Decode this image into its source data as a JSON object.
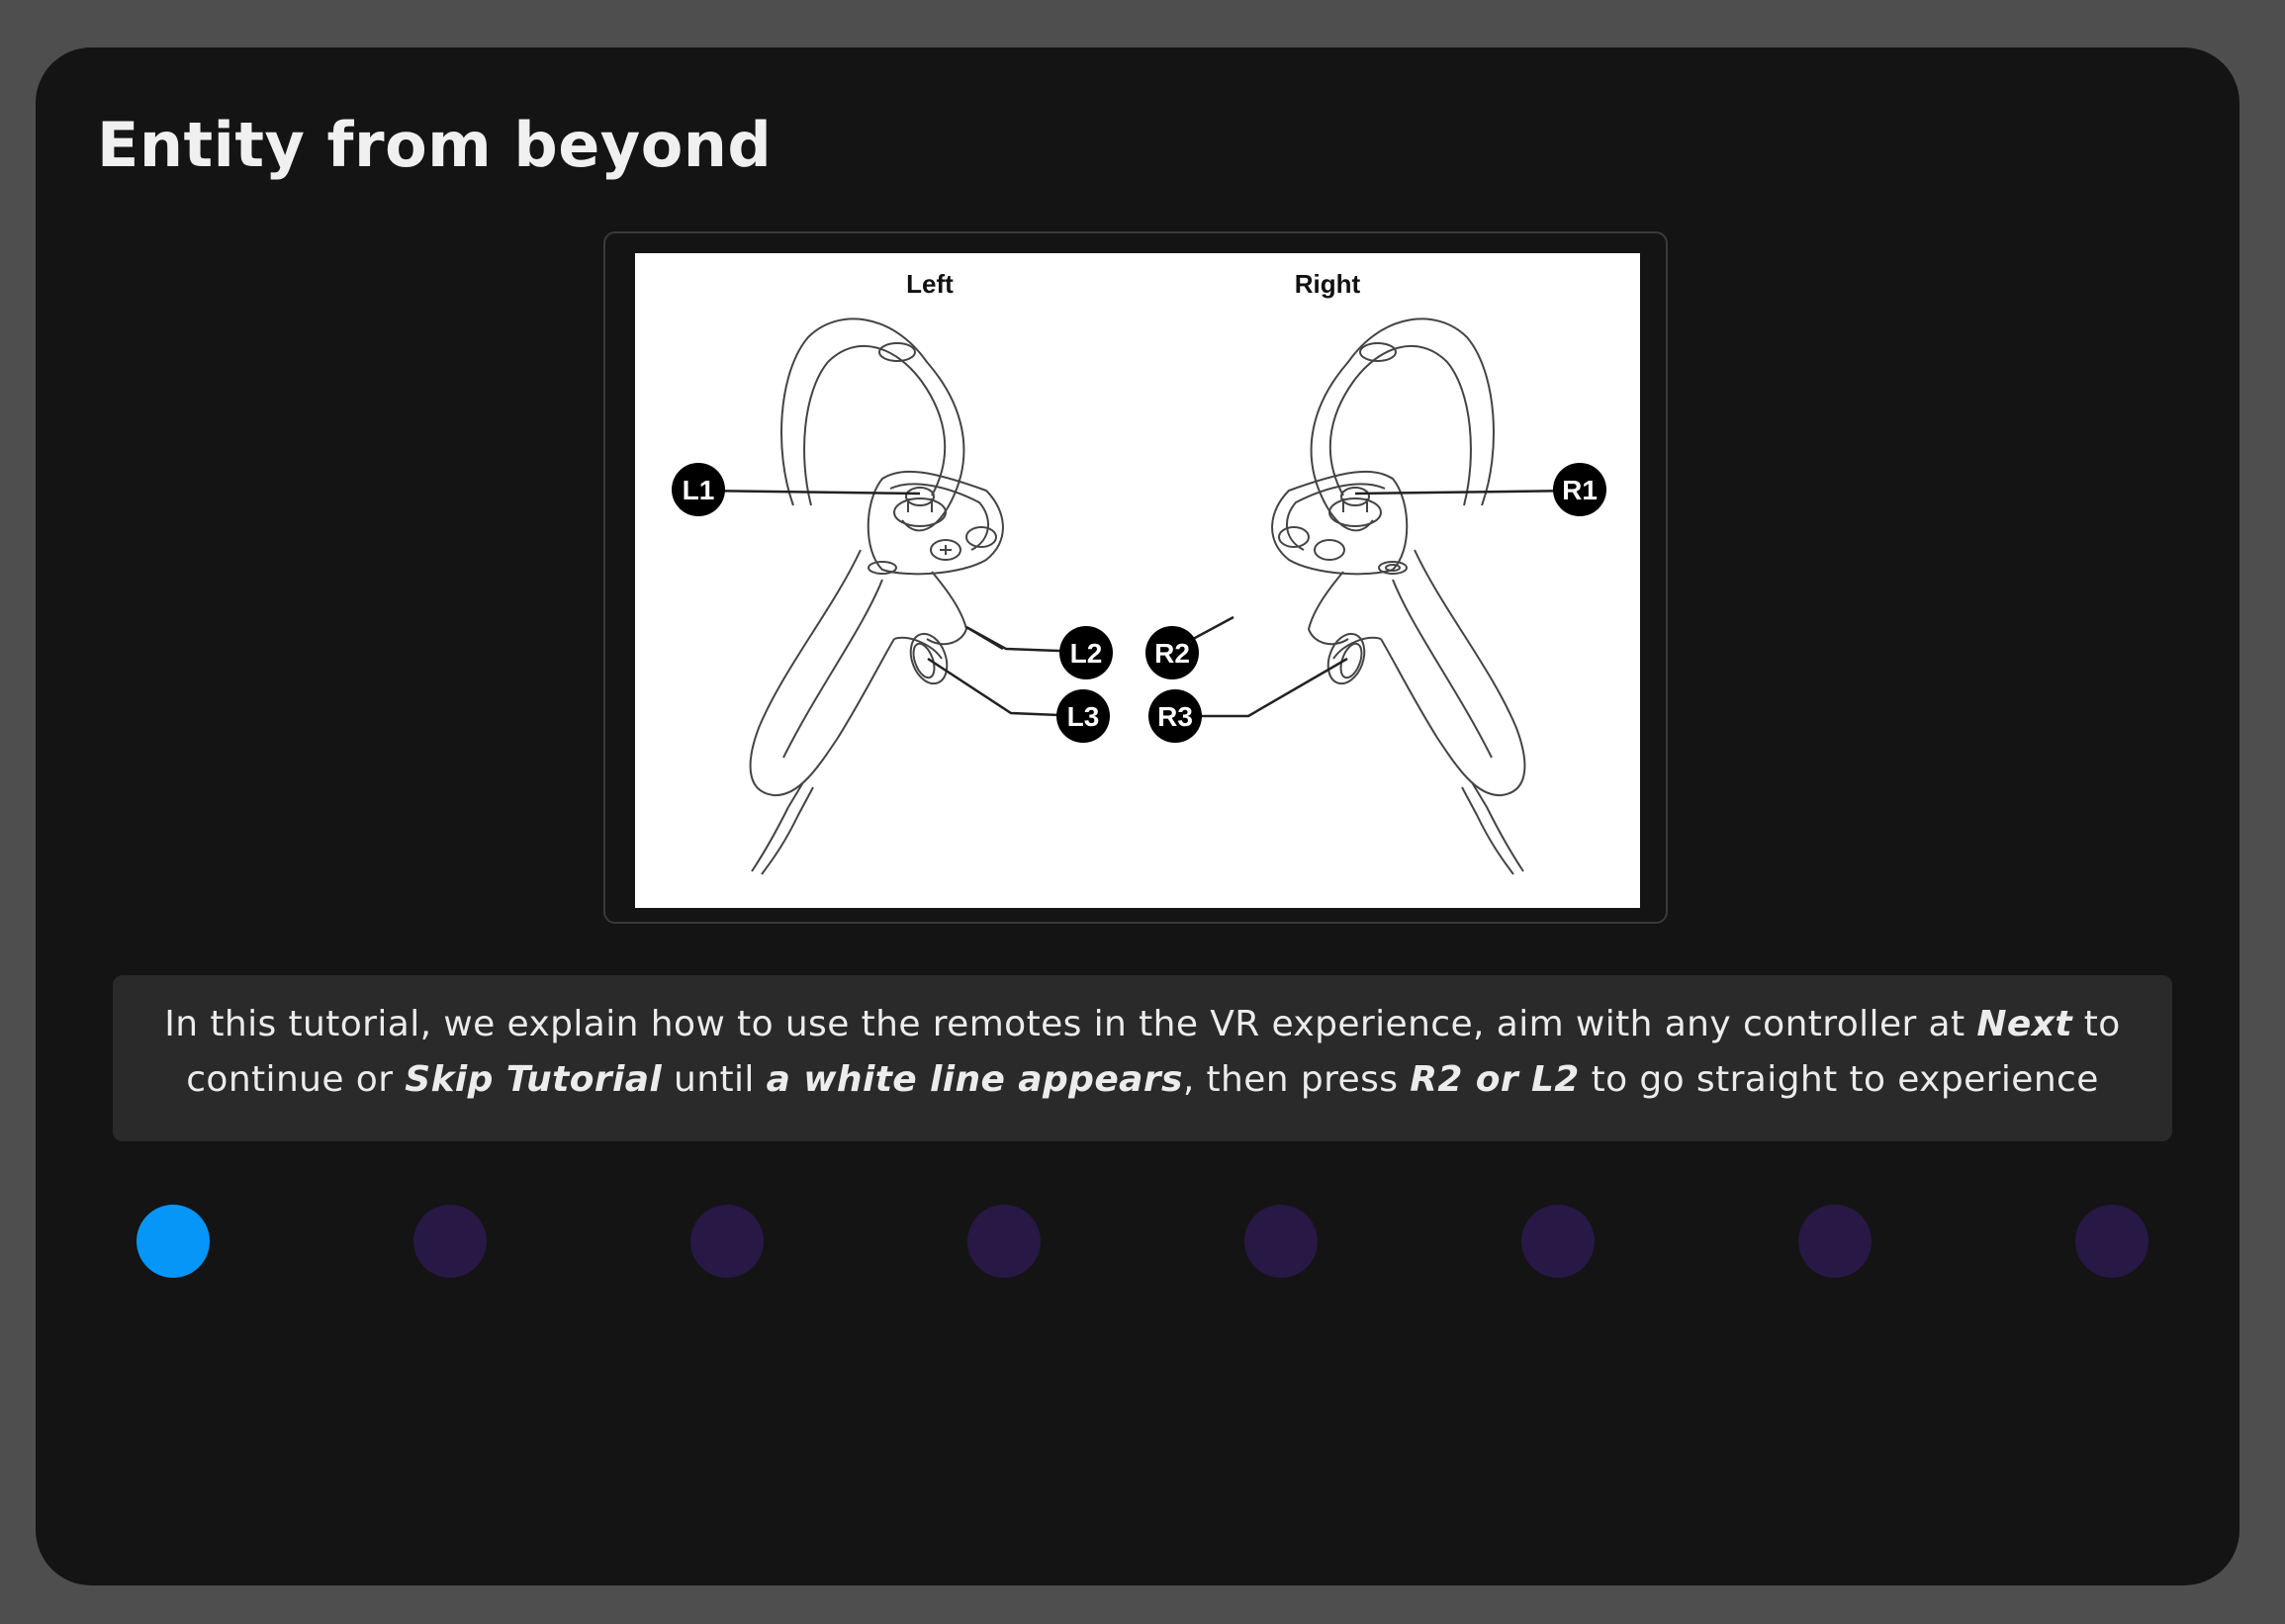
{
  "title": "Entity from beyond",
  "diagram": {
    "left_heading": "Left",
    "right_heading": "Right",
    "labels": {
      "l1": "L1",
      "l2": "L2",
      "l3": "L3",
      "r1": "R1",
      "r2": "R2",
      "r3": "R3"
    }
  },
  "caption": {
    "t1": "In this tutorial, we explain how to use the remotes in the VR experience, aim with any controller at ",
    "b1": "Next",
    "t2": " to continue or ",
    "b2": "Skip Tutorial",
    "t3": " until ",
    "b3": "a white line appears",
    "t4": ", then press ",
    "b4": "R2 or L2",
    "t5": "  to go straight to experience"
  },
  "pagination": {
    "total": 8,
    "active_index": 0
  },
  "colors": {
    "active_dot": "#0596f8",
    "inactive_dot": "#271845",
    "panel_bg": "#141414",
    "page_bg": "#4e4e4e"
  }
}
